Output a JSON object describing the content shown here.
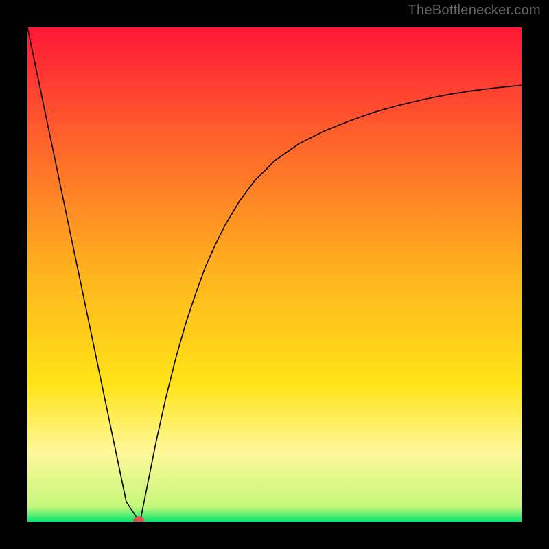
{
  "watermark": "TheBottlenecker.com",
  "colors": {
    "top": "#ff1736",
    "mid_upper": "#ff6a2a",
    "mid": "#ffb41e",
    "mid_lower": "#ffe317",
    "pale_yellow": "#fff89a",
    "bottom": "#06e66d",
    "curve": "#000000",
    "marker": "#d9534f",
    "background": "#000000"
  },
  "chart_data": {
    "type": "line",
    "title": "",
    "xlabel": "",
    "ylabel": "",
    "xlim": [
      0,
      100
    ],
    "ylim": [
      0,
      100
    ],
    "grid": false,
    "x": [
      0,
      2,
      4,
      6,
      8,
      10,
      12,
      14,
      16,
      18,
      20,
      22,
      22.5,
      23,
      24,
      26,
      28,
      30,
      32,
      34,
      36,
      38,
      40,
      43,
      46,
      50,
      55,
      60,
      65,
      70,
      75,
      80,
      85,
      90,
      95,
      100
    ],
    "values": [
      100,
      90.4,
      80.8,
      71.2,
      61.6,
      52.0,
      42.4,
      32.8,
      23.2,
      13.6,
      4.0,
      1.0,
      0.2,
      1.0,
      6.0,
      16.0,
      25.0,
      33.0,
      40.0,
      46.0,
      51.5,
      56.0,
      60.0,
      65.0,
      69.0,
      73.0,
      76.5,
      79.0,
      81.0,
      82.8,
      84.2,
      85.4,
      86.4,
      87.2,
      87.8,
      88.3
    ],
    "annotations": [
      {
        "kind": "marker",
        "x": 22.5,
        "y": 0.2,
        "color": "#d9534f",
        "shape": "ellipse"
      }
    ]
  }
}
